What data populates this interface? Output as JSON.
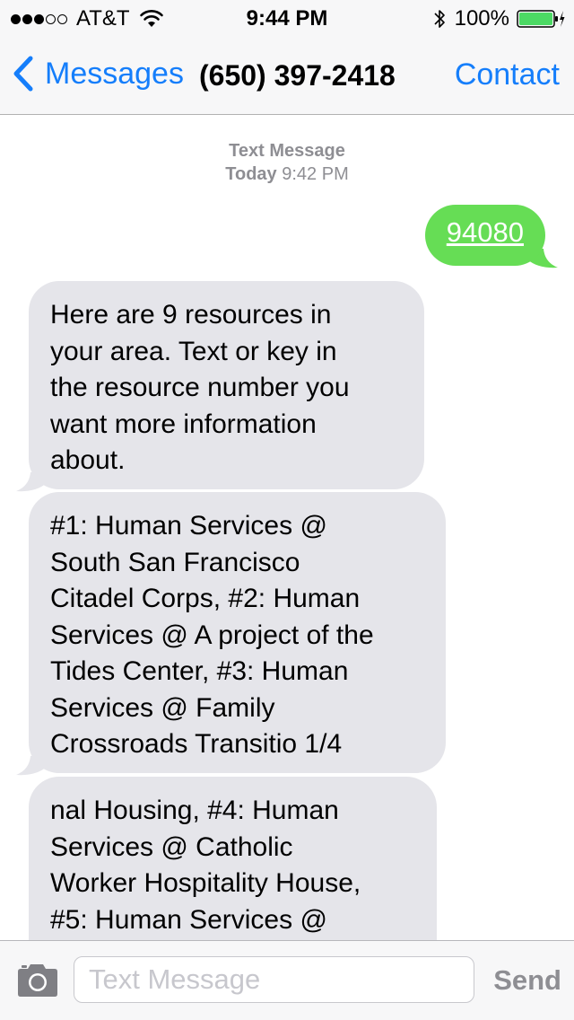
{
  "status_bar": {
    "carrier": "AT&T",
    "signal_bars_filled": 3,
    "signal_bars_total": 5,
    "time": "9:44 PM",
    "battery_percent": "100%"
  },
  "nav": {
    "back_label": "Messages",
    "title": "(650) 397-2418",
    "contact_label": "Contact"
  },
  "conversation": {
    "header_type": "Text Message",
    "header_day": "Today",
    "header_time": "9:42 PM",
    "messages": [
      {
        "direction": "outgoing",
        "text": "94080"
      },
      {
        "direction": "incoming",
        "lines": [
          "Here are 9 resources in",
          "your area. Text or key in",
          "the resource number you",
          "want more information",
          "about."
        ]
      },
      {
        "direction": "incoming",
        "lines": [
          "#1: Human Services @",
          "South San Francisco",
          "Citadel Corps, #2: Human",
          "Services @ A project of the",
          "Tides Center, #3: Human",
          "Services @ Family",
          "Crossroads Transitio 1/4"
        ]
      },
      {
        "direction": "incoming",
        "lines": [
          "nal Housing, #4: Human",
          "Services @ Catholic",
          "Worker Hospitality House,",
          "#5: Human Services @",
          "",
          ""
        ]
      }
    ]
  },
  "composer": {
    "placeholder": "Text Message",
    "value": "",
    "send_label": "Send"
  },
  "colors": {
    "ios_blue": "#157efb",
    "outgoing_bubble": "#66dd55",
    "incoming_bubble": "#e5e5ea",
    "battery_green": "#4cd964"
  },
  "icons": {
    "wifi": "wifi-icon",
    "bluetooth": "bluetooth-icon",
    "battery": "battery-icon",
    "charging": "charging-bolt-icon",
    "back": "chevron-left-icon",
    "camera": "camera-icon"
  }
}
